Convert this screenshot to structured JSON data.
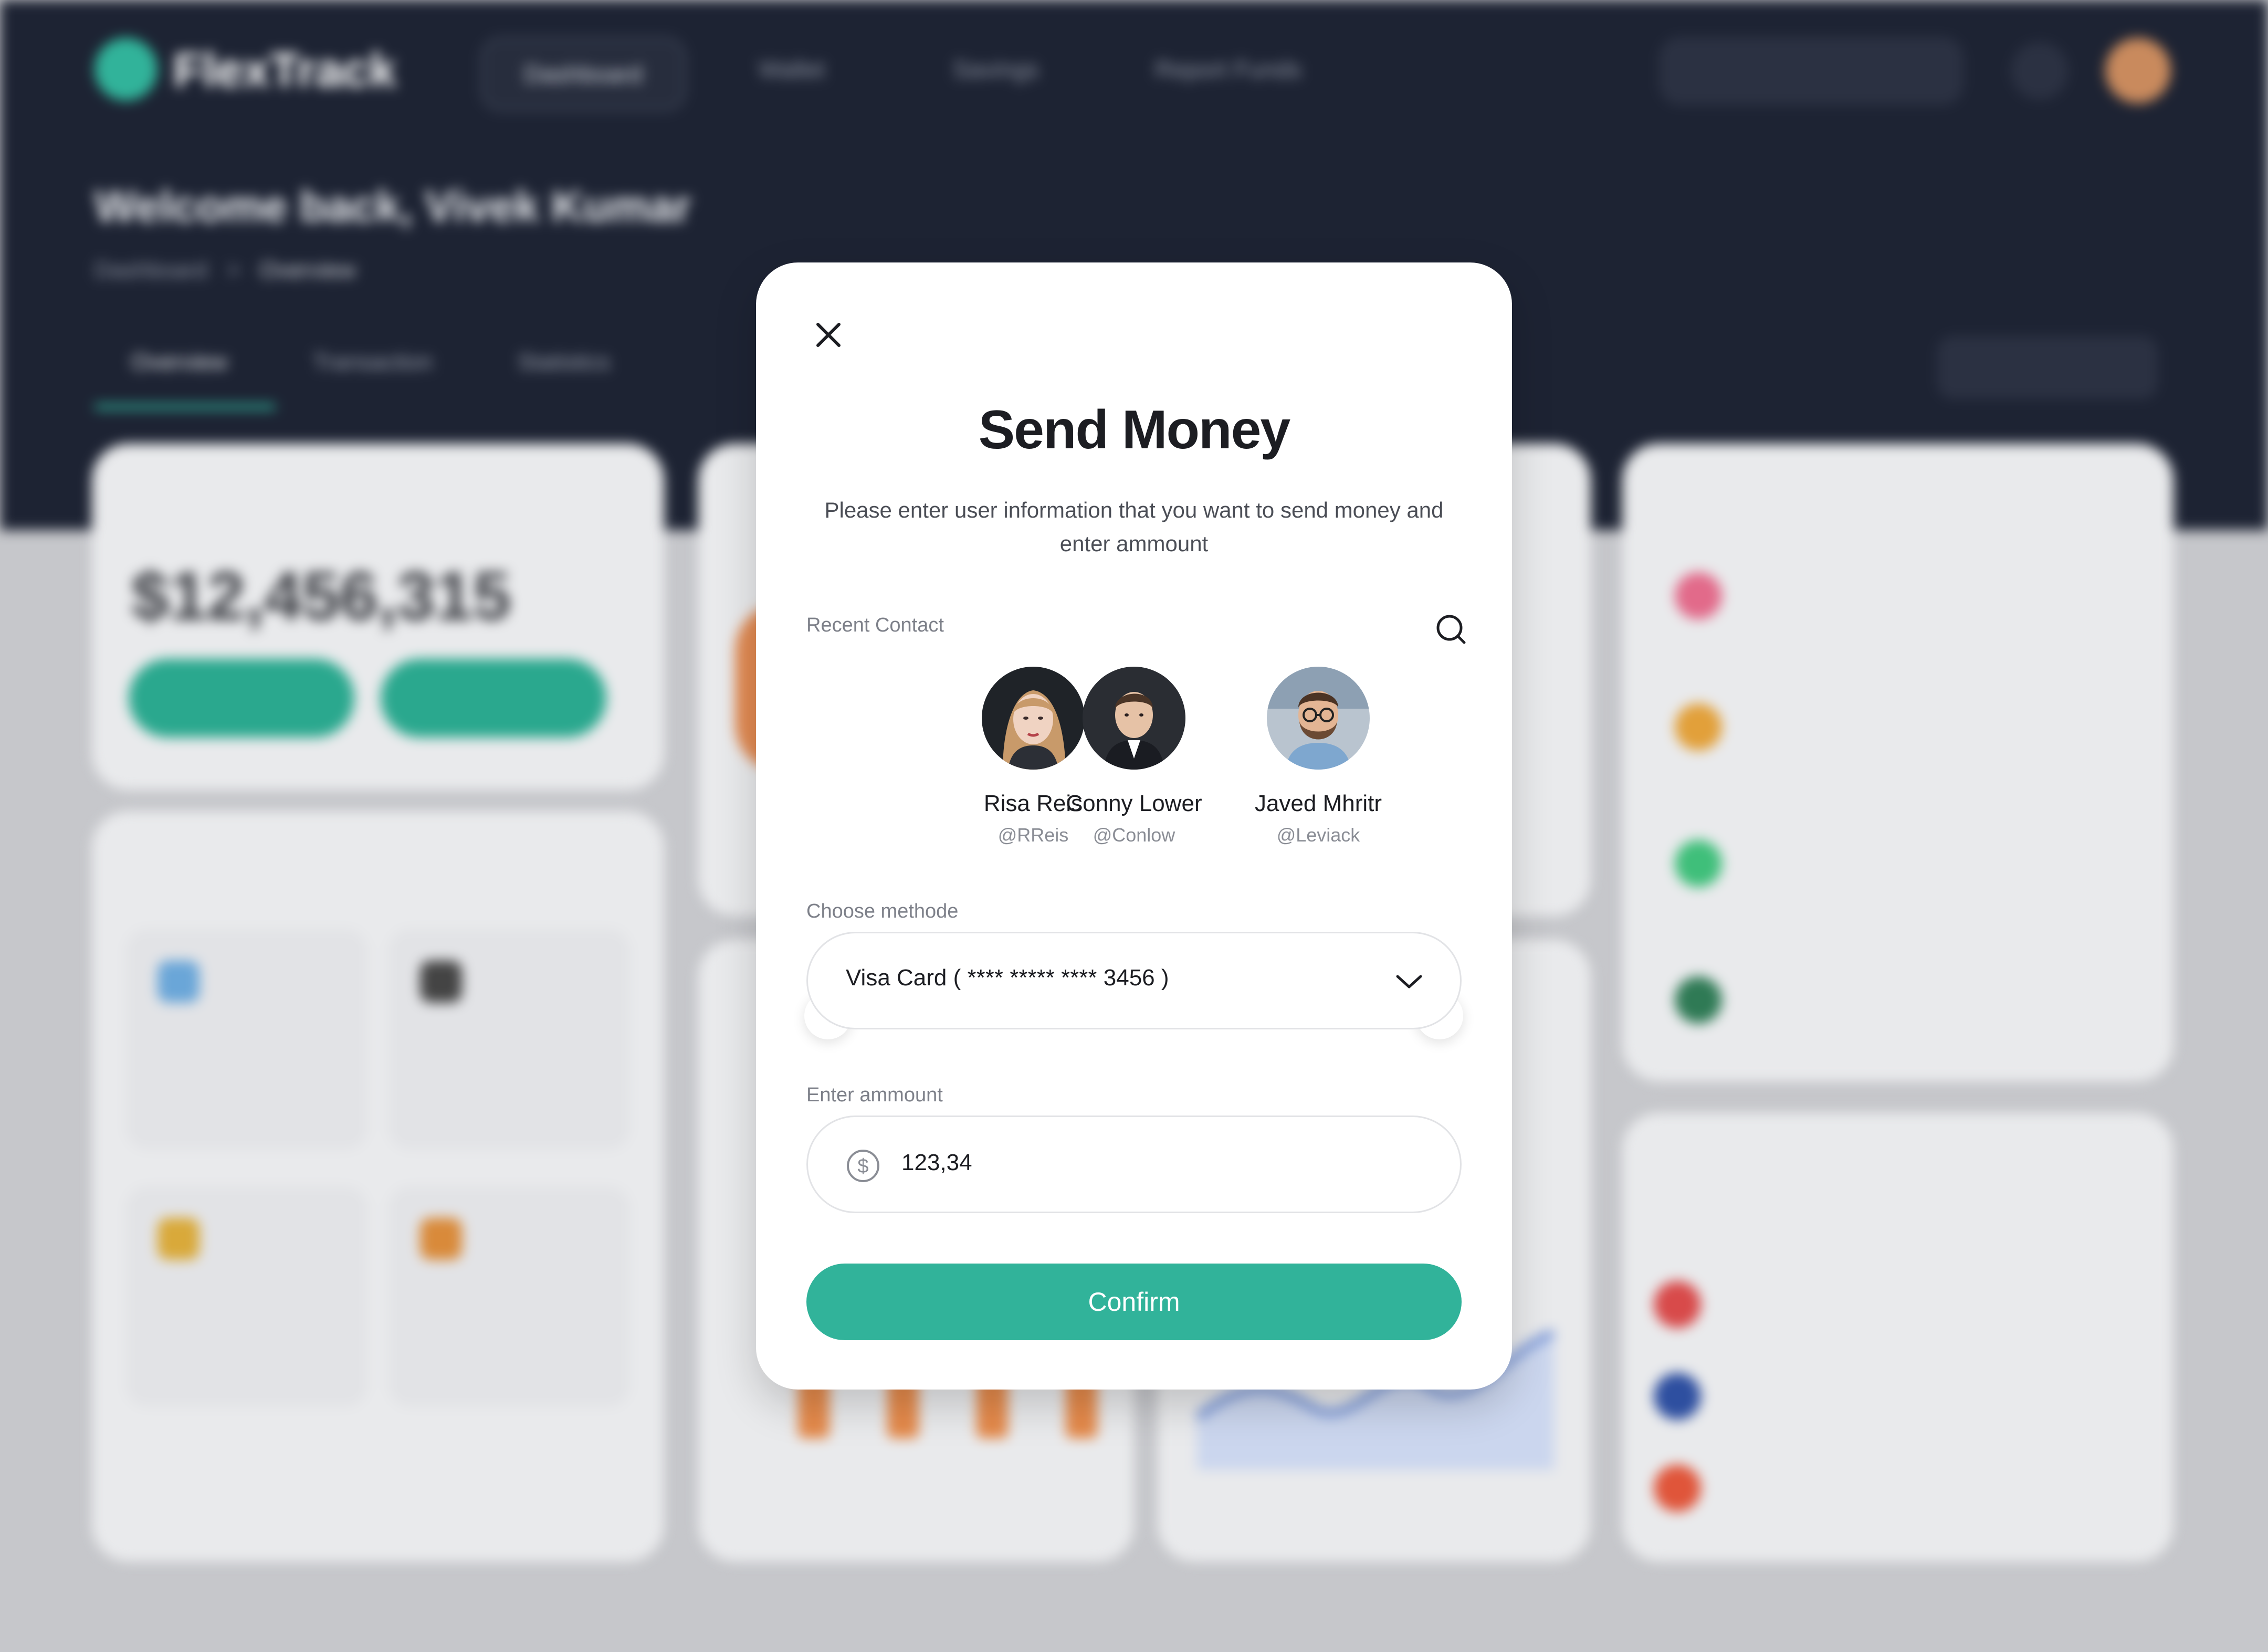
{
  "background": {
    "app_name": "FlexTrack",
    "nav": [
      "Dashboard",
      "Wallet",
      "Savings",
      "Report Funds"
    ],
    "welcome": "Welcome back, Vivek Kumar",
    "breadcrumb": [
      "Dashboard",
      ">",
      "Overview"
    ],
    "tabs": [
      "Overview",
      "Transaction",
      "Statistics"
    ],
    "total_balance": "$12,456,315",
    "colors": {
      "dark_band": "#1d2333",
      "accent": "#31b39a"
    }
  },
  "modal": {
    "title": "Send Money",
    "subtitle": "Please enter user information that you want to send money and enter ammount",
    "recent_contact_label": "Recent Contact",
    "contacts": [
      {
        "name": "Risa Reis",
        "handle": "@RReis"
      },
      {
        "name": "Conny Lower",
        "handle": "@Conlow"
      },
      {
        "name": "Javed Mhritr",
        "handle": "@Leviack"
      }
    ],
    "method_label": "Choose methode",
    "method_value": "Visa Card ( ****  ***** **** 3456 )",
    "amount_label": "Enter ammount",
    "amount_value": "123,34",
    "confirm_label": "Confirm",
    "icons": {
      "close": "close-icon",
      "search": "search-icon",
      "prev": "chevron-left-icon",
      "next": "chevron-right-icon",
      "dropdown": "chevron-down-icon",
      "currency": "dollar-icon"
    },
    "colors": {
      "accent": "#31b39a",
      "text": "#1c1d22",
      "muted": "#7d8089"
    }
  }
}
